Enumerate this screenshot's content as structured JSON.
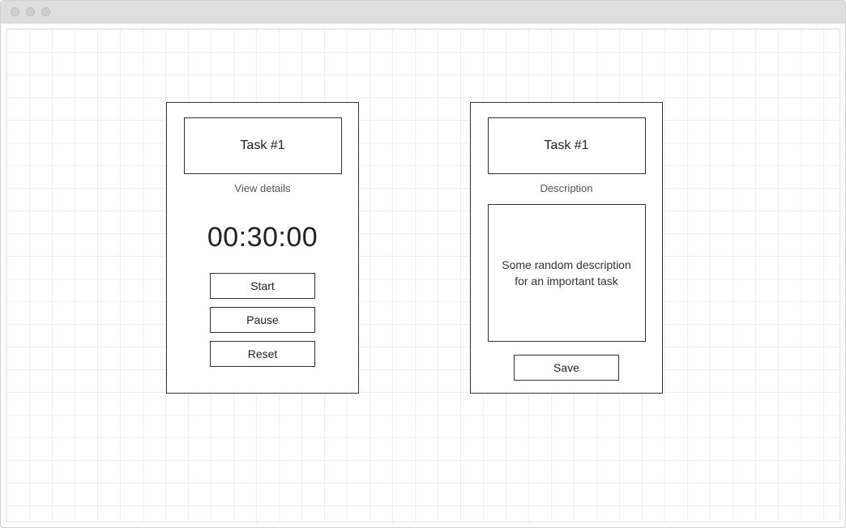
{
  "left_card": {
    "title": "Task #1",
    "view_details_label": "View details",
    "timer_value": "00:30:00",
    "buttons": {
      "start": "Start",
      "pause": "Pause",
      "reset": "Reset"
    }
  },
  "right_card": {
    "title": "Task #1",
    "description_label": "Description",
    "description_text": "Some random description for an important task",
    "save_label": "Save"
  }
}
